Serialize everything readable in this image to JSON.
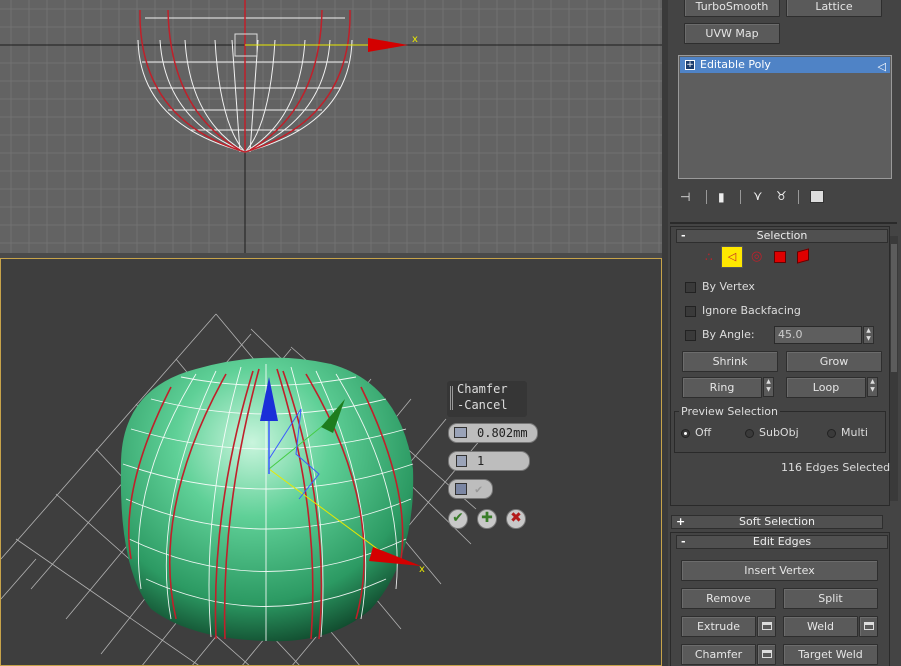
{
  "modifier_buttons": {
    "turbosmooth": "TurboSmooth",
    "lattice": "Lattice",
    "uvw_map": "UVW Map"
  },
  "modifier_stack": {
    "items": [
      {
        "label": "Editable Poly"
      }
    ]
  },
  "selection_rollout": {
    "title": "Selection",
    "by_vertex": "By Vertex",
    "ignore_backfacing": "Ignore Backfacing",
    "by_angle": "By Angle:",
    "angle_value": "45.0",
    "shrink": "Shrink",
    "grow": "Grow",
    "ring": "Ring",
    "loop": "Loop",
    "preview_group": "Preview Selection",
    "preview_options": [
      "Off",
      "SubObj",
      "Multi"
    ],
    "preview_selected": "Off",
    "status": "116 Edges Selected"
  },
  "soft_selection": {
    "title": "Soft Selection",
    "sign": "+"
  },
  "edit_edges": {
    "title": "Edit Edges",
    "sign": "-",
    "insert_vertex": "Insert Vertex",
    "remove": "Remove",
    "split": "Split",
    "extrude": "Extrude",
    "weld": "Weld",
    "chamfer": "Chamfer",
    "target_weld": "Target Weld"
  },
  "chamfer_caddy": {
    "title_line1": "Chamfer",
    "title_line2": "-Cancel",
    "amount": "0.802mm",
    "segments": "1"
  },
  "axis_labels": {
    "x": "x"
  },
  "colors": {
    "accent_selection": "#4f83c6",
    "edge_selection": "#c0202a",
    "active_viewport_border": "#c7a34a",
    "sphere": "#4cbf84"
  }
}
